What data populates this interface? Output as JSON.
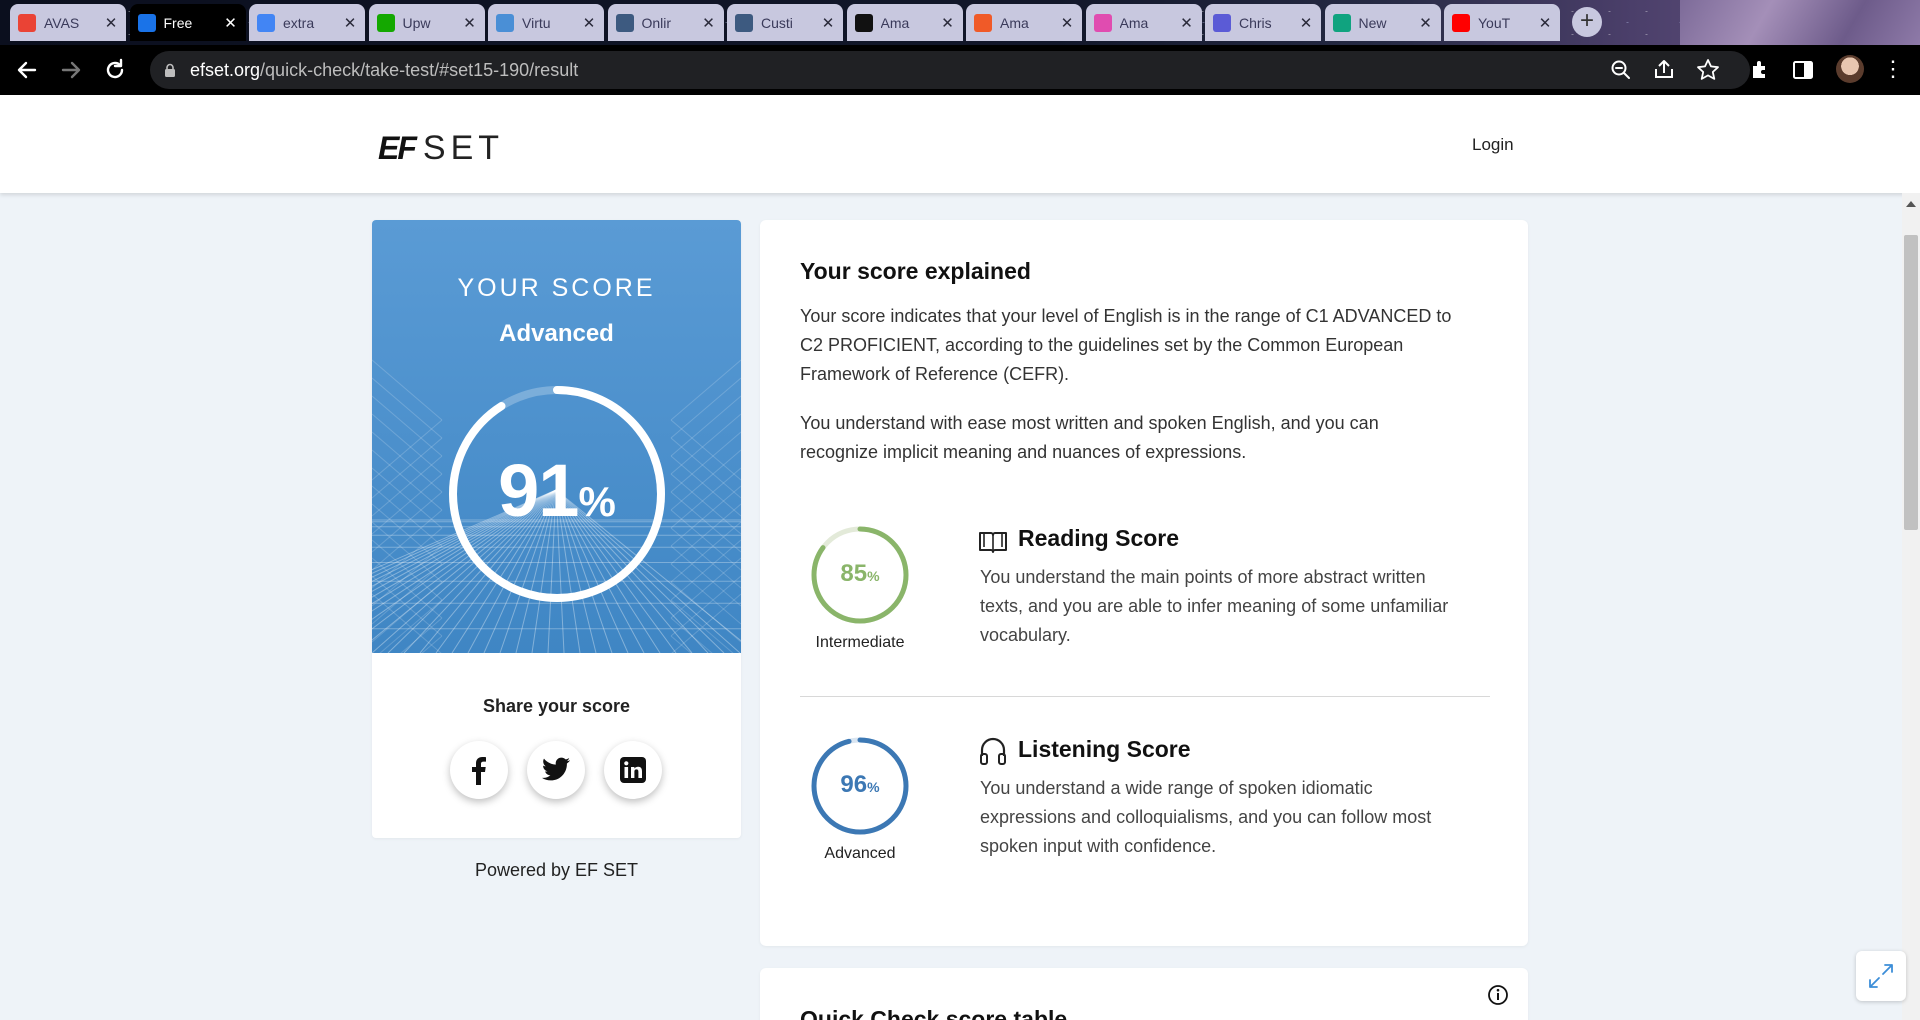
{
  "browser": {
    "tabs": [
      {
        "title": "AVAS",
        "favicon": "gmail-icon",
        "color": "#ea4335",
        "active": false
      },
      {
        "title": "Free",
        "favicon": "ef-icon",
        "color": "#1a73e8",
        "active": true
      },
      {
        "title": "extra",
        "favicon": "google-icon",
        "color": "#4285f4",
        "active": false
      },
      {
        "title": "Upw",
        "favicon": "upwork-icon",
        "color": "#14a800",
        "active": false
      },
      {
        "title": "Virtu",
        "favicon": "virtual-icon",
        "color": "#4a8fd6",
        "active": false
      },
      {
        "title": "Onlir",
        "favicon": "globe-icon",
        "color": "#3d5a80",
        "active": false
      },
      {
        "title": "Custi",
        "favicon": "globe-icon",
        "color": "#3d5a80",
        "active": false
      },
      {
        "title": "Ama",
        "favicon": "circle-icon",
        "color": "#111111",
        "active": false
      },
      {
        "title": "Ama",
        "favicon": "bars-icon",
        "color": "#f05a28",
        "active": false
      },
      {
        "title": "Ama",
        "favicon": "colorful-icon",
        "color": "#e04cb0",
        "active": false
      },
      {
        "title": "Chris",
        "favicon": "bot-icon",
        "color": "#5b5bd6",
        "active": false
      },
      {
        "title": "New",
        "favicon": "openai-icon",
        "color": "#10a37f",
        "active": false
      },
      {
        "title": "YouT",
        "favicon": "youtube-icon",
        "color": "#ff0000",
        "active": false
      }
    ],
    "new_tab": "+",
    "url_host": "efset.org",
    "url_path": "/quick-check/take-test/#set15-190/result"
  },
  "header": {
    "logo_ef": "EF",
    "logo_set": "SET",
    "login": "Login"
  },
  "score": {
    "heading": "YOUR SCORE",
    "level": "Advanced",
    "value": "91",
    "percent_symbol": "%",
    "progress": 0.91,
    "share_title": "Share your score",
    "social": [
      "facebook-icon",
      "twitter-icon",
      "linkedin-icon"
    ],
    "powered_by": "Powered by EF SET"
  },
  "explain": {
    "title": "Your score explained",
    "p1_line1": "Your score indicates that your level of English is in the range of C1 ADVANCED to",
    "p1_line2": "C2 PROFICIENT, according to the guidelines set by the Common European",
    "p1_line3": "Framework of Reference (CEFR).",
    "p2_line1": "You understand with ease most written and spoken English, and you can",
    "p2_line2": "recognize implicit meaning and nuances of expressions.",
    "reading": {
      "value": "85",
      "percent_symbol": "%",
      "progress": 0.85,
      "level": "Intermediate",
      "title": "Reading Score",
      "desc_line1": "You understand the main points of more abstract written",
      "desc_line2": "texts, and you are able to infer meaning of some unfamiliar",
      "desc_line3": "vocabulary.",
      "color": "#8ab56a"
    },
    "listening": {
      "value": "96",
      "percent_symbol": "%",
      "progress": 0.96,
      "level": "Advanced",
      "title": "Listening Score",
      "desc_line1": "You understand a wide range of spoken idiomatic",
      "desc_line2": "expressions and colloquialisms, and you can follow most",
      "desc_line3": "spoken input with confidence.",
      "color": "#3c78b4"
    }
  },
  "table_card": {
    "title": "Quick Check score table"
  },
  "colors": {
    "score_blue": "#4a90cc",
    "page_bg": "#eef3f8"
  }
}
